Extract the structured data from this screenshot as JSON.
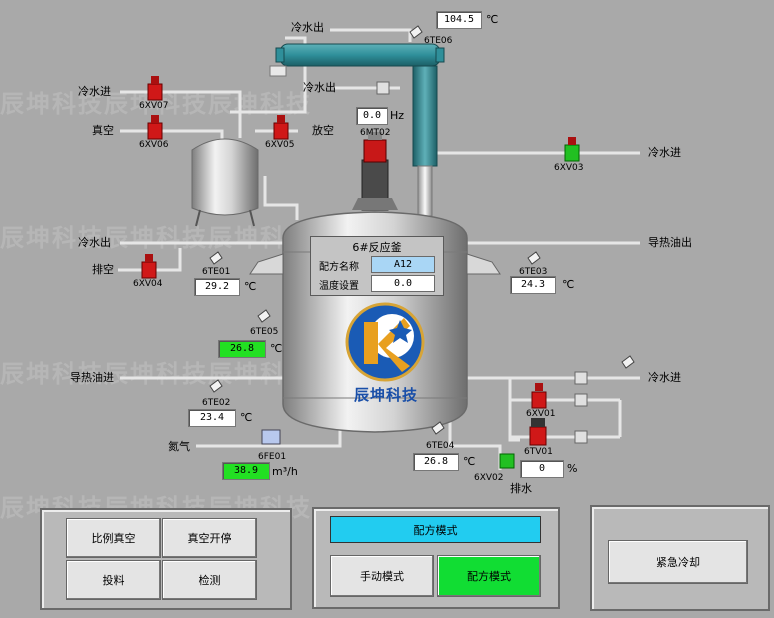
{
  "labels": {
    "cold_out_top": "冷水出",
    "cold_in_left": "冷水进",
    "vacuum": "真空",
    "vent": "放空",
    "cold_out_mid": "冷水出",
    "cold_in_right": "冷水进",
    "cold_out_left": "冷水出",
    "drain_left": "排空",
    "heat_oil_out": "导热油出",
    "heat_oil_in": "导热油进",
    "cold_in_bottom": "冷水进",
    "nitrogen": "氮气",
    "drain_water": "排水"
  },
  "tags": {
    "te06": "6TE06",
    "xv07": "6XV07",
    "xv06": "6XV06",
    "xv05": "6XV05",
    "mt02": "6MT02",
    "xv03": "6XV03",
    "te01": "6TE01",
    "xv04": "6XV04",
    "te03": "6TE03",
    "te05": "6TE05",
    "te02": "6TE02",
    "fe01": "6FE01",
    "te04": "6TE04",
    "xv01": "6XV01",
    "tv01": "6TV01",
    "xv02": "6XV02"
  },
  "readings": {
    "te06": {
      "value": "104.5",
      "unit": "℃"
    },
    "mt02": {
      "value": "0.0",
      "unit": "Hz"
    },
    "te01": {
      "value": "29.2",
      "unit": "℃"
    },
    "te03": {
      "value": "24.3",
      "unit": "℃"
    },
    "te05": {
      "value": "26.8",
      "unit": "℃"
    },
    "te02": {
      "value": "23.4",
      "unit": "℃"
    },
    "fe01": {
      "value": "38.9",
      "unit": "m³/h"
    },
    "te04": {
      "value": "26.8",
      "unit": "℃"
    },
    "tv01": {
      "value": "0",
      "unit": "%"
    }
  },
  "reactor": {
    "title": "6#反应釜",
    "recipe_label": "配方名称",
    "recipe_value": "A12",
    "temp_label": "温度设置",
    "temp_value": "0.0",
    "brand_text": "辰坤科技"
  },
  "watermark": "辰坤科技辰坤科技辰坤科技",
  "controls": {
    "btn_ratio_vacuum": "比例真空",
    "btn_vacuum_toggle": "真空开停",
    "btn_feed": "投料",
    "btn_detect": "检测",
    "mode_display": "配方模式",
    "btn_manual_mode": "手动模式",
    "btn_recipe_mode": "配方模式",
    "btn_emergency_cool": "紧急冷却"
  },
  "colors": {
    "background": "#a9a9a9",
    "pipe": "#e8e8e8",
    "valve_open": "#22c022",
    "valve_closed": "#d01818",
    "green_value": "#22e022",
    "mode_display": "#22ccf0",
    "active_mode": "#11dd33",
    "condenser": "#2f8f9a"
  },
  "icons": [
    "valve-icon",
    "temperature-sensor-icon",
    "motor-icon",
    "flow-meter-icon",
    "company-logo"
  ]
}
